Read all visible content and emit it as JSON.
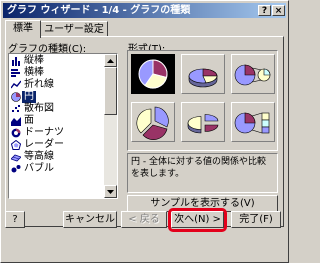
{
  "window": {
    "title": "グラフ ウィザード - 1/4 - グラフの種類",
    "help_glyph": "?",
    "close_glyph": "×"
  },
  "tabs": [
    {
      "label": "標準",
      "active": true
    },
    {
      "label": "ユーザー設定",
      "active": false
    }
  ],
  "chart_type_list": {
    "label": "グラフの種類(C):",
    "items": [
      {
        "label": "縦棒",
        "icon": "column-chart-icon"
      },
      {
        "label": "横棒",
        "icon": "bar-chart-icon"
      },
      {
        "label": "折れ線",
        "icon": "line-chart-icon"
      },
      {
        "label": "円",
        "icon": "pie-chart-icon",
        "selected": true
      },
      {
        "label": "散布図",
        "icon": "scatter-chart-icon"
      },
      {
        "label": "面",
        "icon": "area-chart-icon"
      },
      {
        "label": "ドーナツ",
        "icon": "doughnut-chart-icon"
      },
      {
        "label": "レーダー",
        "icon": "radar-chart-icon"
      },
      {
        "label": "等高線",
        "icon": "surface-chart-icon"
      },
      {
        "label": "バブル",
        "icon": "bubble-chart-icon"
      }
    ]
  },
  "subtype": {
    "label": "形式(T):",
    "selected_index": 0
  },
  "description": "円 - 全体に対する値の関係や比較を表します。",
  "preview_button": "サンプルを表示する(V)",
  "footer": {
    "help_label": "?",
    "cancel_label": "キャンセル",
    "back_label": "< 戻る",
    "next_label": "次へ(N) >",
    "finish_label": "完了(F)"
  },
  "colors": {
    "face": "#d4d0c8",
    "titlebar_start": "#0a246a",
    "titlebar_end": "#a6caf0",
    "selection": "#0a246a",
    "highlight_ring": "#e3001b",
    "pie_blue": "#9999ff",
    "pie_purple": "#993366",
    "pie_yellow": "#ffffcc",
    "pie_cyan": "#ccffff"
  }
}
